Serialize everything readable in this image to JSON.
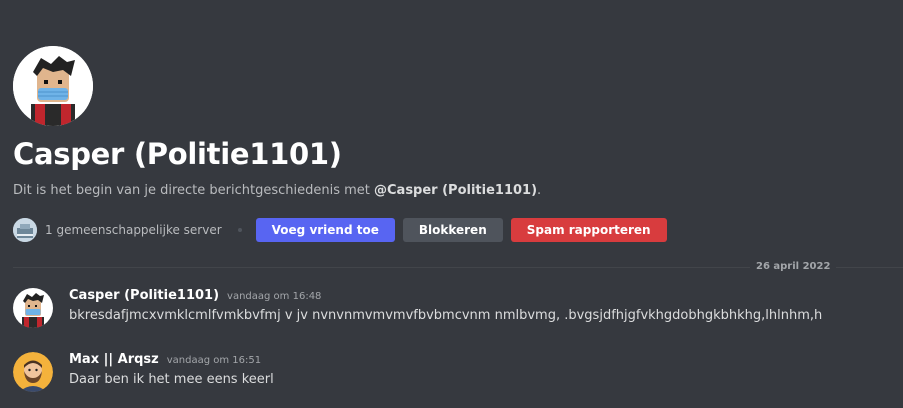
{
  "profile": {
    "name": "Casper (Politie1101)",
    "intro_prefix": "Dit is het begin van je directe berichtgeschiedenis met ",
    "intro_mention": "@Casper (Politie1101)",
    "intro_suffix": ".",
    "mutual_servers": "1 gemeenschappelijke server",
    "buttons": {
      "add_friend": "Voeg vriend toe",
      "block": "Blokkeren",
      "report_spam": "Spam rapporteren"
    }
  },
  "divider": {
    "date": "26 april 2022"
  },
  "messages": [
    {
      "author": "Casper (Politie1101)",
      "timestamp": "vandaag om 16:48",
      "text": "bkresdafjmcxvmklcmlfvmkbvfmj v jv  nvnvnmvmvmvfbvbmcvnm nmlbvmg, .bvgsjdfhjgfvkhgdobhgkbhkhg,lhlnhm,h"
    },
    {
      "author": "Max || Arqsz",
      "timestamp": "vandaag om 16:51",
      "text": "Daar ben ik het mee eens keerl"
    }
  ],
  "colors": {
    "background": "#36393f",
    "primary_button": "#5865f2",
    "secondary_button": "#4f545c",
    "danger_button": "#d83c3e"
  },
  "icons": {
    "profile_avatar": "roblox-avatar-with-mask",
    "server_icon": "server-icon",
    "second_avatar": "bearded-avatar"
  }
}
